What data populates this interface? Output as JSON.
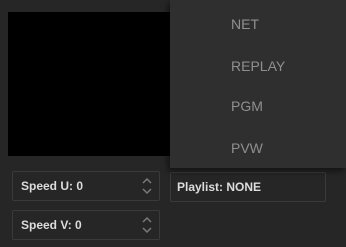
{
  "menu": {
    "items": [
      {
        "label": "NET"
      },
      {
        "label": "REPLAY"
      },
      {
        "label": "PGM"
      },
      {
        "label": "PVW"
      }
    ]
  },
  "speed_u": {
    "label": "Speed U: 0",
    "icon": "spinner-icon"
  },
  "speed_v": {
    "label": "Speed V: 0",
    "icon": "spinner-icon"
  },
  "playlist": {
    "label": "Playlist: NONE"
  },
  "colors": {
    "menu_text": "#8f8f8f",
    "background": "#262626",
    "preview": "#000000"
  }
}
